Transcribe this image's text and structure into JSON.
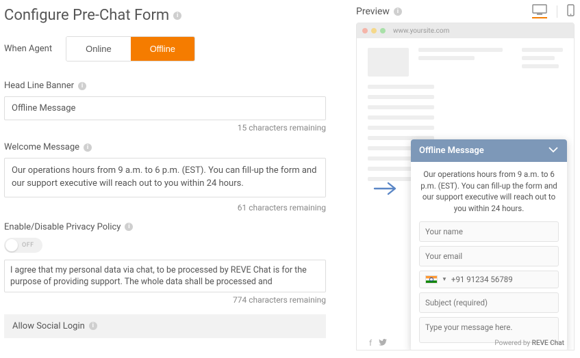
{
  "left": {
    "title": "Configure Pre-Chat Form",
    "when_agent_label": "When Agent",
    "seg_online": "Online",
    "seg_offline": "Offline",
    "headline_label": "Head Line Banner",
    "headline_value": "Offline Message",
    "headline_remaining": "15 characters remaining",
    "welcome_label": "Welcome Message",
    "welcome_value": "Our operations hours from 9 a.m. to 6 p.m. (EST). You can fill-up the form and our support executive will reach out to you within 24 hours.",
    "welcome_remaining": "61 characters remaining",
    "privacy_label": "Enable/Disable Privacy Policy",
    "toggle_state": "OFF",
    "privacy_text": "I agree that my personal data via chat, to be processed by REVE Chat is for the purpose of providing support. The whole data shall be processed and",
    "privacy_remaining": "774 characters remaining",
    "social_label": "Allow Social Login"
  },
  "right": {
    "preview_label": "Preview",
    "url": "www.yoursite.com",
    "chat": {
      "title": "Offline Message",
      "message": "Our operations hours from 9 a.m. to 6 p.m. (EST). You can fill-up the form and our support executive will reach out to you within 24 hours.",
      "name_ph": "Your name",
      "email_ph": "Your email",
      "phone_ph": "+91 91234 56789",
      "subject_ph": "Subject (required)",
      "msg_ph": "Type your message here.",
      "powered_prefix": "Powered by ",
      "powered_brand": "REVE Chat"
    }
  }
}
